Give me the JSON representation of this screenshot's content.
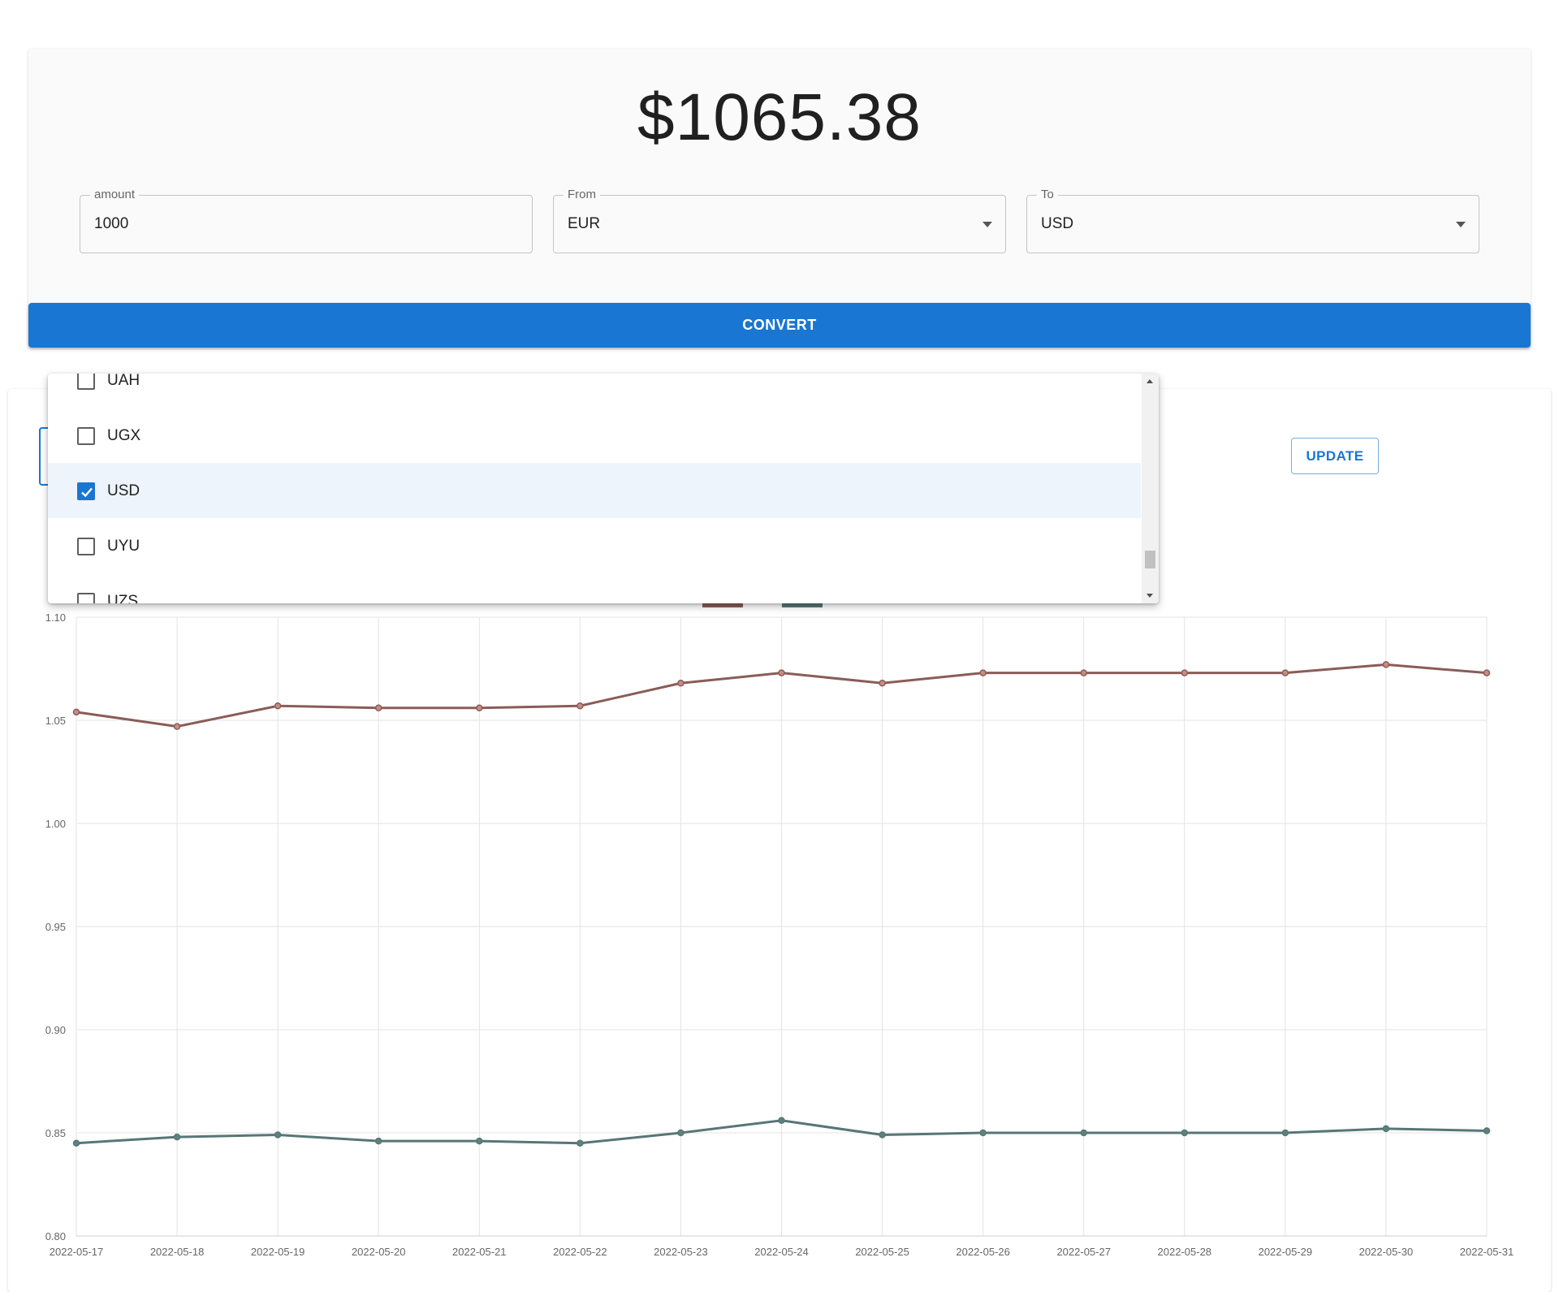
{
  "converter": {
    "result": "$1065.38",
    "amount": {
      "label": "amount",
      "value": "1000"
    },
    "from": {
      "label": "From",
      "value": "EUR"
    },
    "to": {
      "label": "To",
      "value": "USD"
    },
    "convert_label": "CONVERT"
  },
  "history": {
    "update_label": "UPDATE",
    "dropdown": {
      "items": [
        {
          "code": "UAH",
          "checked": false
        },
        {
          "code": "UGX",
          "checked": false
        },
        {
          "code": "USD",
          "checked": true
        },
        {
          "code": "UYU",
          "checked": false
        },
        {
          "code": "UZS",
          "checked": false
        }
      ]
    }
  },
  "colors": {
    "primary": "#1976d2",
    "usd_series": "#8a5c58",
    "gbp_series": "#587676"
  },
  "chart_data": {
    "type": "line",
    "x": [
      "2022-05-17",
      "2022-05-18",
      "2022-05-19",
      "2022-05-20",
      "2022-05-21",
      "2022-05-22",
      "2022-05-23",
      "2022-05-24",
      "2022-05-25",
      "2022-05-26",
      "2022-05-27",
      "2022-05-28",
      "2022-05-29",
      "2022-05-30",
      "2022-05-31"
    ],
    "series": [
      {
        "values": [
          1.054,
          1.047,
          1.057,
          1.056,
          1.056,
          1.057,
          1.068,
          1.073,
          1.068,
          1.073,
          1.073,
          1.073,
          1.073,
          1.077,
          1.073
        ]
      },
      {
        "values": [
          0.845,
          0.848,
          0.849,
          0.846,
          0.846,
          0.845,
          0.85,
          0.856,
          0.849,
          0.85,
          0.85,
          0.85,
          0.85,
          0.852,
          0.851
        ]
      }
    ],
    "ylim": [
      0.8,
      1.1
    ],
    "yticks": [
      "0.80",
      "0.85",
      "0.90",
      "0.95",
      "1.00",
      "1.05",
      "1.10"
    ],
    "grid": true,
    "legend": "top-center"
  }
}
